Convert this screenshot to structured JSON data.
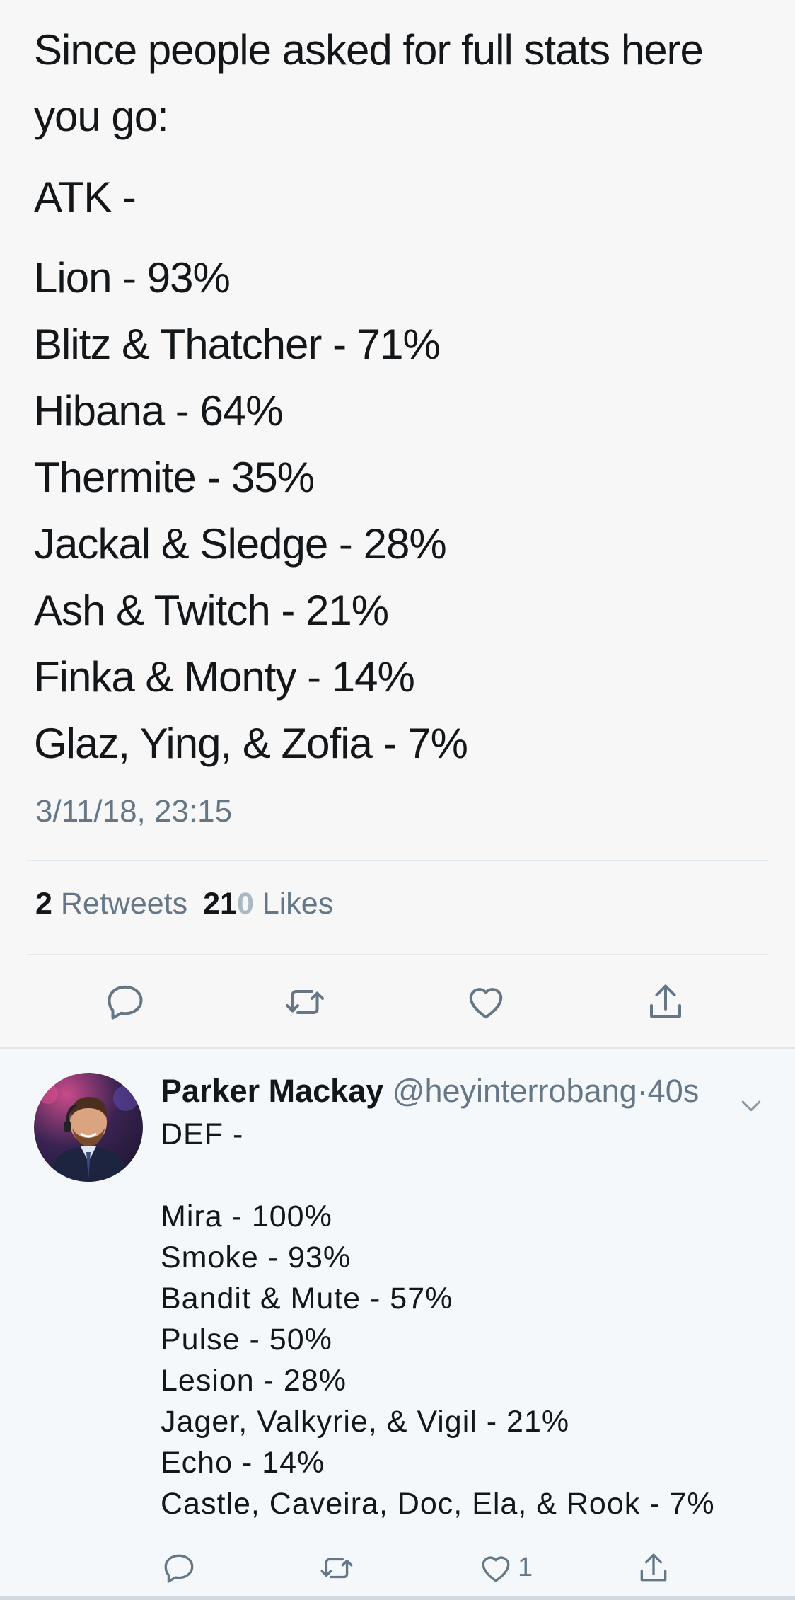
{
  "main_tweet": {
    "text_lines": [
      "Since people asked for full stats here",
      "you go:",
      "ATK -",
      "Lion - 93%",
      "Blitz & Thatcher - 71%",
      "Hibana - 64%",
      "Thermite - 35%",
      "Jackal & Sledge - 28%",
      "Ash & Twitch - 21%",
      "Finka & Monty - 14%",
      "Glaz, Ying, & Zofia - 7%"
    ],
    "timestamp": "3/11/18, 23:15",
    "retweets_count": "2",
    "retweets_label": "Retweets",
    "likes_count_bold": "21",
    "likes_count_faded": "0",
    "likes_label": "Likes",
    "actions": [
      "reply-icon",
      "retweet-icon",
      "like-icon",
      "share-icon"
    ]
  },
  "reply": {
    "name": "Parker Mackay",
    "handle": "@heyinterrobang",
    "separator": "·",
    "time": "40s",
    "text_lines": [
      "DEF -",
      "",
      "Mira - 100%",
      "Smoke - 93%",
      "Bandit & Mute - 57%",
      "Pulse - 50%",
      "Lesion - 28%",
      "Jager, Valkyrie, & Vigil - 21%",
      "Echo - 14%",
      "Castle, Caveira, Doc, Ela, & Rook - 7%"
    ],
    "like_count": "1"
  },
  "colors": {
    "text": "#14171a",
    "secondary": "#657786",
    "divider": "#e1e8ed",
    "background": "#f5f8fa"
  }
}
